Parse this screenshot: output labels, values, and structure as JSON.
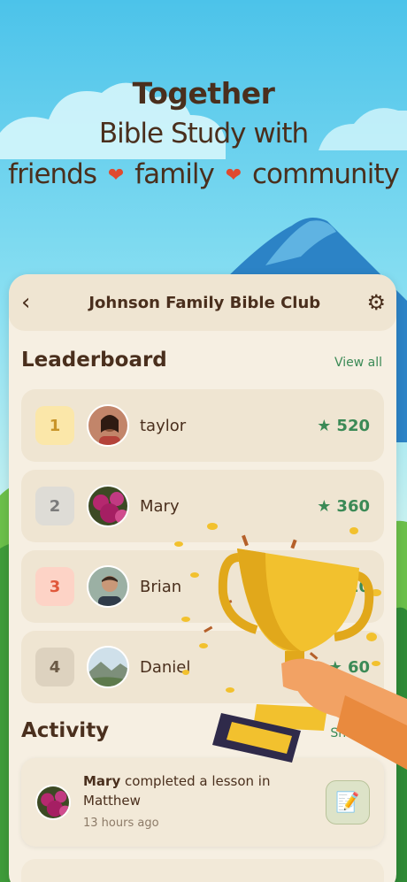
{
  "hero": {
    "line1": "Together",
    "line2": "Bible Study with",
    "word1": "friends",
    "word2": "family",
    "word3": "community"
  },
  "header": {
    "title": "Johnson Family Bible Club"
  },
  "leaderboard": {
    "title": "Leaderboard",
    "view_all": "View all",
    "rows": [
      {
        "rank": "1",
        "name": "taylor",
        "score": "520",
        "rank_bg": "#fbe7a9",
        "rank_color": "#c8952a"
      },
      {
        "rank": "2",
        "name": "Mary",
        "score": "360",
        "rank_bg": "#dedcd6",
        "rank_color": "#7b7b7b"
      },
      {
        "rank": "3",
        "name": "Brian",
        "score": "120",
        "rank_bg": "#fdd3c6",
        "rank_color": "#e0583b"
      },
      {
        "rank": "4",
        "name": "Daniel",
        "score": "60",
        "rank_bg": "#ddd2bf",
        "rank_color": "#6b5a46"
      }
    ]
  },
  "activity": {
    "title": "Activity",
    "show_all": "Show all",
    "item": {
      "user": "Mary",
      "text": "completed a lesson in Matthew",
      "time": "13 hours ago"
    }
  },
  "colors": {
    "accent_green": "#3b8a56",
    "text_brown": "#4a2f1d",
    "heart": "#e04a2f"
  }
}
